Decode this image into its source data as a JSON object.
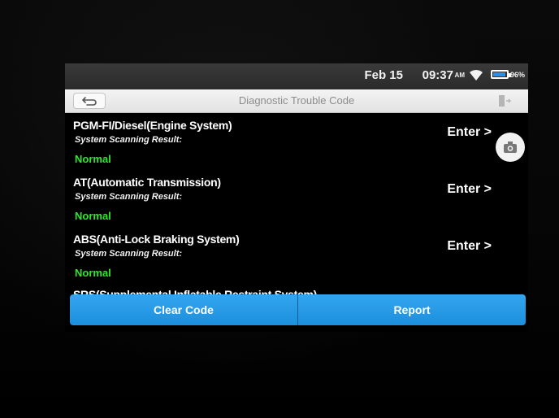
{
  "status_bar": {
    "date": "Feb 15",
    "time": "09:37",
    "ampm": "AM",
    "battery_percent": "96%",
    "battery_level": 0.96,
    "icons": [
      "wifi-icon",
      "battery-icon"
    ]
  },
  "title_bar": {
    "title": "Diagnostic Trouble Code",
    "icons": [
      "back-arrow-icon",
      "exit-icon"
    ]
  },
  "systems": [
    {
      "name": "PGM-FI/Diesel(Engine System)",
      "label": "System Scanning Result:",
      "result": "Normal",
      "action": "Enter >"
    },
    {
      "name": "AT(Automatic Transmission)",
      "label": "System Scanning Result:",
      "result": "Normal",
      "action": "Enter >"
    },
    {
      "name": "ABS(Anti-Lock Braking System)",
      "label": "System Scanning Result:",
      "result": "Normal",
      "action": "Enter >"
    },
    {
      "name": "SRS(Supplemental Inflatable Restraint System)"
    }
  ],
  "buttons": {
    "clear_code": "Clear Code",
    "report": "Report"
  },
  "floating": {
    "icon": "camera-icon"
  },
  "colors": {
    "button_blue": "#2b9be6",
    "normal_green": "#2ee62e",
    "statusbar": "#333333",
    "titlebar": "#ececec"
  }
}
